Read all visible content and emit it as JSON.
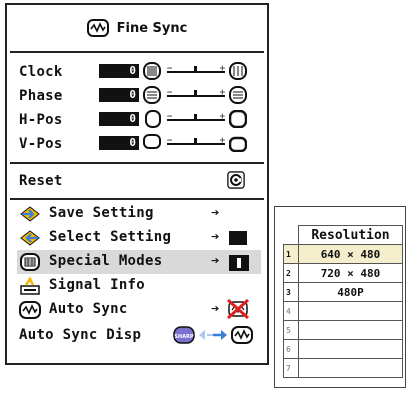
{
  "menu": {
    "title": "Fine Sync",
    "title_icon": "waveform-monitor-icon",
    "adjustments": [
      {
        "label": "Clock",
        "value": "0",
        "left_icon": "clock-dense-icon",
        "right_icon": "clock-sparse-icon"
      },
      {
        "label": "Phase",
        "value": "0",
        "left_icon": "phase-icon",
        "right_icon": "phase-icon"
      },
      {
        "label": "H-Pos",
        "value": "0",
        "left_icon": "position-left-icon",
        "right_icon": "position-right-icon"
      },
      {
        "label": "V-Pos",
        "value": "0",
        "left_icon": "position-up-icon",
        "right_icon": "position-down-icon"
      }
    ],
    "slider_minus": "−",
    "slider_plus": "+",
    "reset": {
      "label": "Reset",
      "icon": "reset-c-icon"
    },
    "items": [
      {
        "label": "Save Setting",
        "icon": "diamond-arrow-right-icon",
        "arrow": "➔"
      },
      {
        "label": "Select Setting",
        "icon": "diamond-arrow-left-icon",
        "arrow": "➔"
      },
      {
        "label": "Special Modes",
        "icon": "special-modes-icon",
        "arrow": "➔"
      },
      {
        "label": "Signal Info",
        "icon": "signal-info-icon",
        "arrow": ""
      },
      {
        "label": "Auto Sync",
        "icon": "auto-sync-icon",
        "arrow": "➔"
      },
      {
        "label": "Auto Sync Disp",
        "icon": "sharp-logo-icon",
        "arrow": ""
      }
    ],
    "selected_item": "Special Modes"
  },
  "resolution_table": {
    "header": "Resolution",
    "rows": [
      {
        "num": "1",
        "value": "640 × 480"
      },
      {
        "num": "2",
        "value": "720 × 480"
      },
      {
        "num": "3",
        "value": "480P"
      },
      {
        "num": "4",
        "value": ""
      },
      {
        "num": "5",
        "value": ""
      },
      {
        "num": "6",
        "value": ""
      },
      {
        "num": "7",
        "value": ""
      }
    ],
    "selected_row": "1"
  },
  "colors": {
    "accent_yellow": "#f5b800",
    "selected_bg": "#d9d9d9",
    "table_selected_bg": "#f5eecc"
  }
}
